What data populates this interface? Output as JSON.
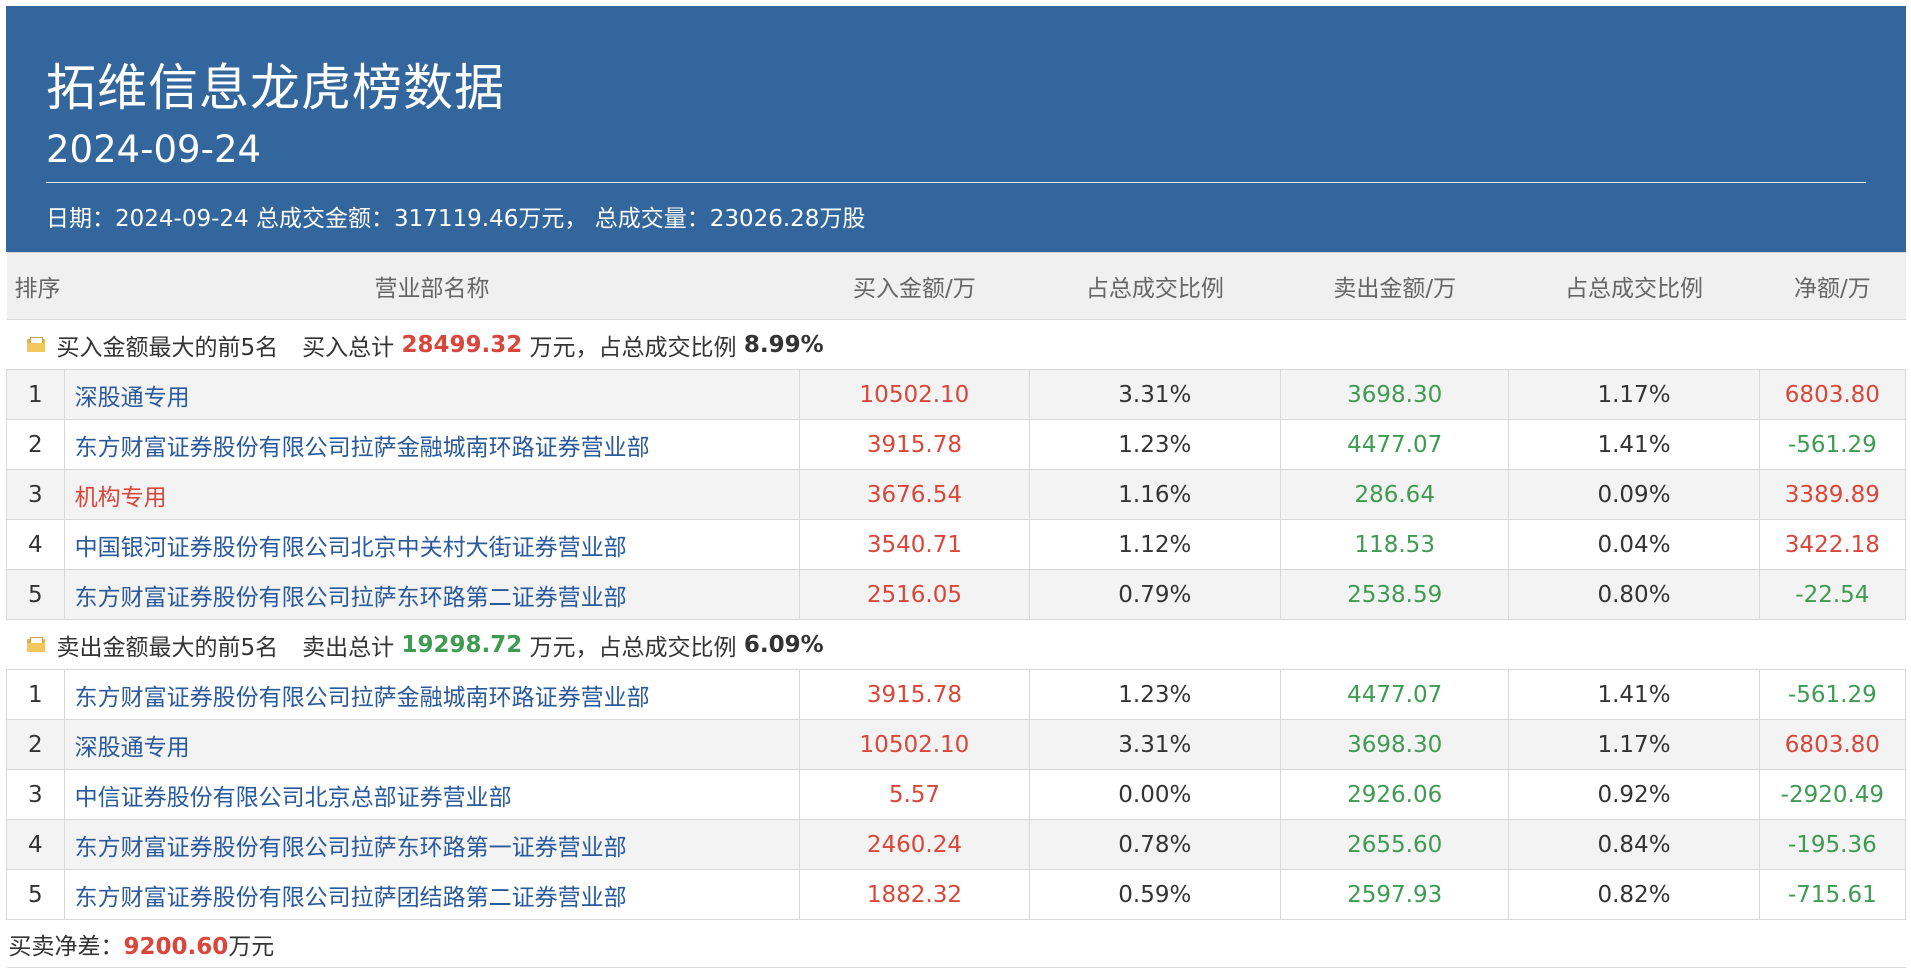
{
  "header": {
    "title": "拓维信息龙虎榜数据",
    "date": "2024-09-24",
    "info_date_label": "日期：",
    "info_date": "2024-09-24",
    "info_amount_label": "总成交金额：",
    "info_amount": "317119.46万元，",
    "info_volume_label": "总成交量：",
    "info_volume": "23026.28万股"
  },
  "columns": [
    "排序",
    "营业部名称",
    "买入金额/万",
    "占总成交比例",
    "卖出金额/万",
    "占总成交比例",
    "净额/万"
  ],
  "buy_section": {
    "label": "买入金额最大的前5名",
    "total_label": "买入总计",
    "total_value": "28499.32",
    "total_suffix": "万元，占总成交比例",
    "ratio": "8.99%",
    "rows": [
      {
        "rank": "1",
        "name": "深股通专用",
        "buy": "10502.10",
        "buy_pct": "3.31%",
        "sell": "3698.30",
        "sell_pct": "1.17%",
        "net": "6803.80"
      },
      {
        "rank": "2",
        "name": "东方财富证券股份有限公司拉萨金融城南环路证券营业部",
        "buy": "3915.78",
        "buy_pct": "1.23%",
        "sell": "4477.07",
        "sell_pct": "1.41%",
        "net": "-561.29"
      },
      {
        "rank": "3",
        "name": "机构专用",
        "buy": "3676.54",
        "buy_pct": "1.16%",
        "sell": "286.64",
        "sell_pct": "0.09%",
        "net": "3389.89"
      },
      {
        "rank": "4",
        "name": "中国银河证券股份有限公司北京中关村大街证券营业部",
        "buy": "3540.71",
        "buy_pct": "1.12%",
        "sell": "118.53",
        "sell_pct": "0.04%",
        "net": "3422.18"
      },
      {
        "rank": "5",
        "name": "东方财富证券股份有限公司拉萨东环路第二证券营业部",
        "buy": "2516.05",
        "buy_pct": "0.79%",
        "sell": "2538.59",
        "sell_pct": "0.80%",
        "net": "-22.54"
      }
    ]
  },
  "sell_section": {
    "label": "卖出金额最大的前5名",
    "total_label": "卖出总计",
    "total_value": "19298.72",
    "total_suffix": "万元，占总成交比例",
    "ratio": "6.09%",
    "rows": [
      {
        "rank": "1",
        "name": "东方财富证券股份有限公司拉萨金融城南环路证券营业部",
        "buy": "3915.78",
        "buy_pct": "1.23%",
        "sell": "4477.07",
        "sell_pct": "1.41%",
        "net": "-561.29"
      },
      {
        "rank": "2",
        "name": "深股通专用",
        "buy": "10502.10",
        "buy_pct": "3.31%",
        "sell": "3698.30",
        "sell_pct": "1.17%",
        "net": "6803.80"
      },
      {
        "rank": "3",
        "name": "中信证券股份有限公司北京总部证券营业部",
        "buy": "5.57",
        "buy_pct": "0.00%",
        "sell": "2926.06",
        "sell_pct": "0.92%",
        "net": "-2920.49"
      },
      {
        "rank": "4",
        "name": "东方财富证券股份有限公司拉萨东环路第一证券营业部",
        "buy": "2460.24",
        "buy_pct": "0.78%",
        "sell": "2655.60",
        "sell_pct": "0.84%",
        "net": "-195.36"
      },
      {
        "rank": "5",
        "name": "东方财富证券股份有限公司拉萨团结路第二证券营业部",
        "buy": "1882.32",
        "buy_pct": "0.59%",
        "sell": "2597.93",
        "sell_pct": "0.82%",
        "net": "-715.61"
      }
    ]
  },
  "footer": {
    "label": "买卖净差：",
    "value": "9200.60",
    "unit": "万元"
  },
  "colors": {
    "header_bg": "#33669c",
    "positive": "#d9473a",
    "negative": "#3f9a52",
    "link": "#2a5a9c"
  },
  "icons": {
    "section_icon": "folder-icon"
  }
}
